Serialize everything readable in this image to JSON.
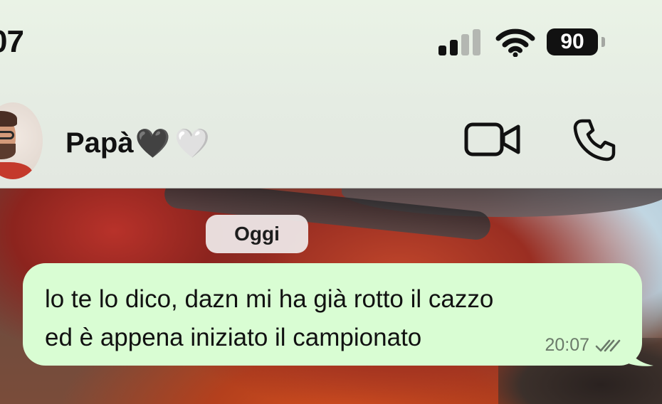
{
  "status_bar": {
    "time": "07",
    "battery": "90"
  },
  "chat_header": {
    "contact_name": "Papà",
    "heart_black": "🖤",
    "heart_white": "🤍"
  },
  "conversation": {
    "date_separator": "Oggi",
    "messages": [
      {
        "lines": [
          "lo te lo dico, dazn mi ha già rotto il cazzo",
          "ed è appena iniziato il campionato"
        ],
        "time": "20:07",
        "status_icon": "double-check-icon"
      }
    ]
  },
  "icons": {
    "signal": "cellular-signal-icon",
    "wifi": "wifi-icon",
    "video_call": "video-camera-icon",
    "voice_call": "phone-icon"
  },
  "colors": {
    "outgoing_bubble": "#d9fdd3",
    "header_background": "#e5ece3",
    "date_pill": "#eee8e8",
    "meta_text": "#6b7a6a"
  }
}
